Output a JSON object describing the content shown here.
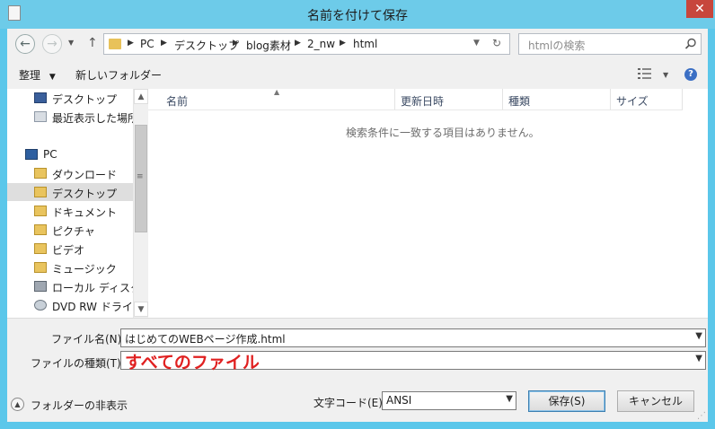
{
  "window": {
    "title": "名前を付けて保存"
  },
  "address": {
    "crumbs": [
      "PC",
      "デスクトップ",
      "blog素材",
      "2_nw",
      "html"
    ]
  },
  "search": {
    "placeholder": "htmlの検索"
  },
  "toolbar": {
    "organize": "整理",
    "new_folder": "新しいフォルダー"
  },
  "nav": {
    "items": [
      {
        "label": "デスクトップ",
        "icon": "desktop-icon"
      },
      {
        "label": "最近表示した場所",
        "icon": "recent-places-icon"
      },
      {
        "label": "PC",
        "icon": "pc-icon"
      },
      {
        "label": "ダウンロード",
        "icon": "downloads-folder-icon"
      },
      {
        "label": "デスクトップ",
        "icon": "desktop-folder-icon"
      },
      {
        "label": "ドキュメント",
        "icon": "documents-folder-icon"
      },
      {
        "label": "ピクチャ",
        "icon": "pictures-folder-icon"
      },
      {
        "label": "ビデオ",
        "icon": "videos-folder-icon"
      },
      {
        "label": "ミュージック",
        "icon": "music-folder-icon"
      },
      {
        "label": "ローカル ディスク (C",
        "icon": "local-disk-icon"
      },
      {
        "label": "DVD RW ドライブ",
        "icon": "dvd-drive-icon"
      }
    ]
  },
  "columns": [
    "名前",
    "更新日時",
    "種類",
    "サイズ"
  ],
  "empty_message": "検索条件に一致する項目はありません。",
  "form": {
    "filename_label": "ファイル名(N):",
    "filename_value": "はじめてのWEBページ作成.html",
    "filetype_label": "ファイルの種類(T):",
    "filetype_value": "すべてのファイル",
    "encoding_label": "文字コード(E):",
    "encoding_value": "ANSI",
    "save_label": "保存(S)",
    "cancel_label": "キャンセル",
    "hide_folders_label": "フォルダーの非表示"
  },
  "colors": {
    "titlebar": "#6dcbe9",
    "close": "#c7463c",
    "filetype_text": "#e02020"
  }
}
